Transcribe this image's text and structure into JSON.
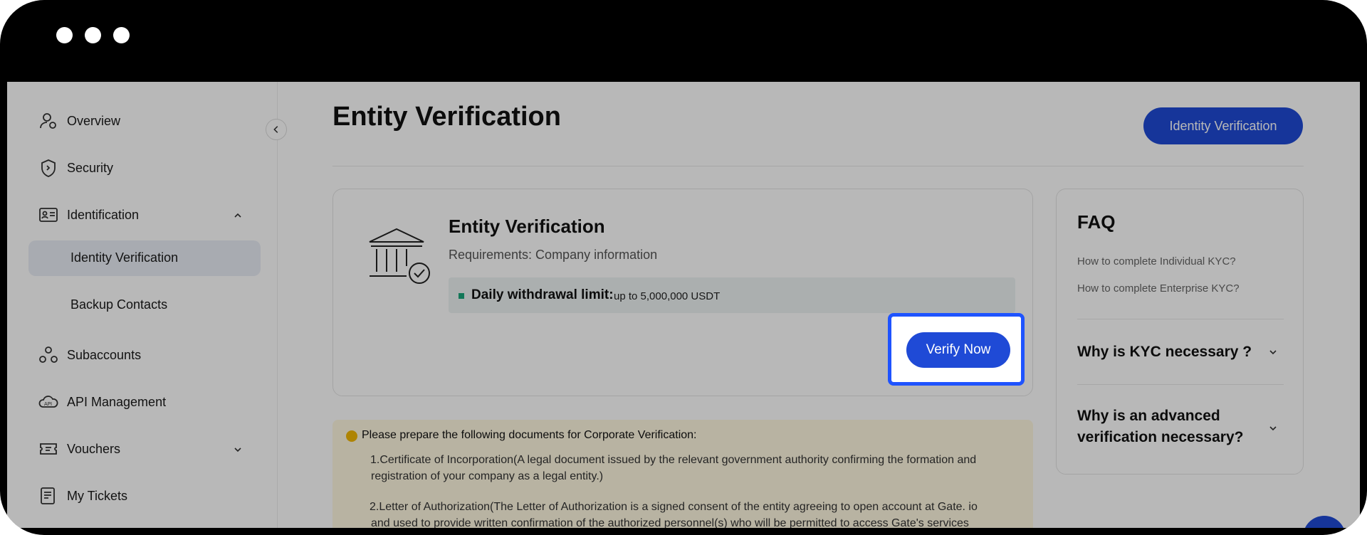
{
  "sidebar": {
    "items": [
      {
        "label": "Overview",
        "icon": "user-icon"
      },
      {
        "label": "Security",
        "icon": "shield-icon"
      },
      {
        "label": "Identification",
        "icon": "id-card-icon"
      },
      {
        "label": "Subaccounts",
        "icon": "subaccounts-icon"
      },
      {
        "label": "API Management",
        "icon": "api-icon"
      },
      {
        "label": "Vouchers",
        "icon": "voucher-icon"
      },
      {
        "label": "My Tickets",
        "icon": "ticket-icon"
      }
    ],
    "sub_items": [
      {
        "label": "Identity Verification"
      },
      {
        "label": "Backup Contacts"
      }
    ]
  },
  "header": {
    "title": "Entity Verification",
    "identity_button": "Identity Verification"
  },
  "card": {
    "title": "Entity Verification",
    "requirements": "Requirements: Company information",
    "limit_label": "Daily withdrawal limit:",
    "limit_value": "up to 5,000,000 USDT",
    "verify_button": "Verify Now"
  },
  "faq": {
    "title": "FAQ",
    "links": [
      "How to complete Individual KYC?",
      "How to complete Enterprise KYC?"
    ],
    "questions": [
      "Why is KYC necessary ?",
      "Why is an advanced",
      "verification necessary?"
    ]
  },
  "notice": {
    "heading": "Please prepare the following documents for Corporate Verification:",
    "lines": [
      "1.Certificate of Incorporation(A legal document issued by the relevant government authority confirming the formation and",
      "registration of your company as a legal entity.)",
      "2.Letter of Authorization(The  Letter of Authorization is a signed consent of the entity agreeing to open  account at Gate. io",
      "and used to provide written confirmation of the  authorized personnel(s) who will be permitted to access Gate's services"
    ]
  },
  "colors": {
    "accent": "#1f4ad6",
    "highlight_border": "#1e53ff",
    "notice_bg": "#fff8e1",
    "limit_dot": "#1aa67a"
  }
}
